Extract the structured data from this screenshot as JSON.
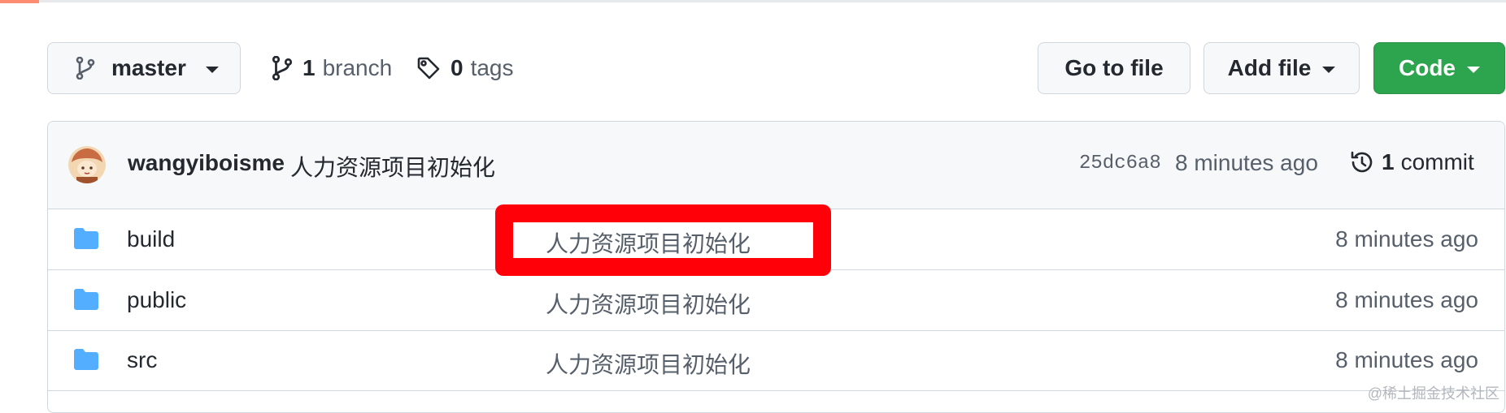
{
  "toolbar": {
    "branch_label": "master",
    "branches_count": "1",
    "branches_label": "branch",
    "tags_count": "0",
    "tags_label": "tags",
    "goto_file_label": "Go to file",
    "add_file_label": "Add file",
    "code_label": "Code"
  },
  "latest_commit": {
    "author": "wangyiboisme",
    "message": "人力资源项目初始化",
    "sha": "25dc6a8",
    "time": "8 minutes ago",
    "commit_count": "1",
    "commit_label": "commit"
  },
  "files": [
    {
      "name": "build",
      "icon": "folder-icon",
      "message": "人力资源项目初始化",
      "time": "8 minutes ago"
    },
    {
      "name": "public",
      "icon": "folder-icon",
      "message": "人力资源项目初始化",
      "time": "8 minutes ago"
    },
    {
      "name": "src",
      "icon": "folder-icon",
      "message": "人力资源项目初始化",
      "time": "8 minutes ago"
    }
  ],
  "watermark": "@稀土掘金技术社区",
  "colors": {
    "accent_green": "#2da44e",
    "folder_blue": "#54aeff",
    "highlight_red": "#ff0008"
  }
}
